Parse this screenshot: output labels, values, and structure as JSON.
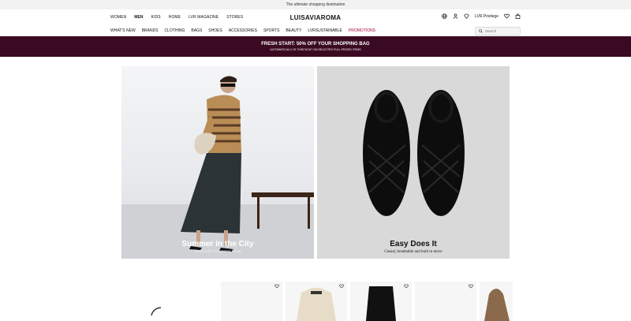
{
  "topbar": {
    "text": "The ultimate shopping destination"
  },
  "header": {
    "nav": [
      "WOMEN",
      "MEN",
      "KIDS",
      "HOME",
      "LVR MAGAZINE",
      "STORES"
    ],
    "logo": "LUISAVIAROMA",
    "privilege": "LVR Privilege"
  },
  "subnav": {
    "items": [
      "WHAT'S NEW",
      "BRANDS",
      "CLOTHING",
      "BAGS",
      "SHOES",
      "ACCESSORIES",
      "SPORTS",
      "BEAUTY",
      "LVRSUSTAINABLE"
    ],
    "promo": "PROMOTIONS",
    "search_placeholder": "Search"
  },
  "promo_band": {
    "title": "FRESH START: 50% OFF YOUR SHOPPING BAG",
    "subtitle": "AUTOMATICALLY AT CHECKOUT ON SELECTED FULL-PRICED ITEMS"
  },
  "hero": [
    {
      "title": "Summer in the City",
      "subtitle": "Sharp rolls for summer living"
    },
    {
      "title": "Easy Does It",
      "subtitle": "Casual, breathable and built to move"
    }
  ],
  "icons": [
    "globe-icon",
    "user-icon",
    "diamond-icon",
    "heart-icon",
    "bag-icon",
    "search-icon"
  ]
}
